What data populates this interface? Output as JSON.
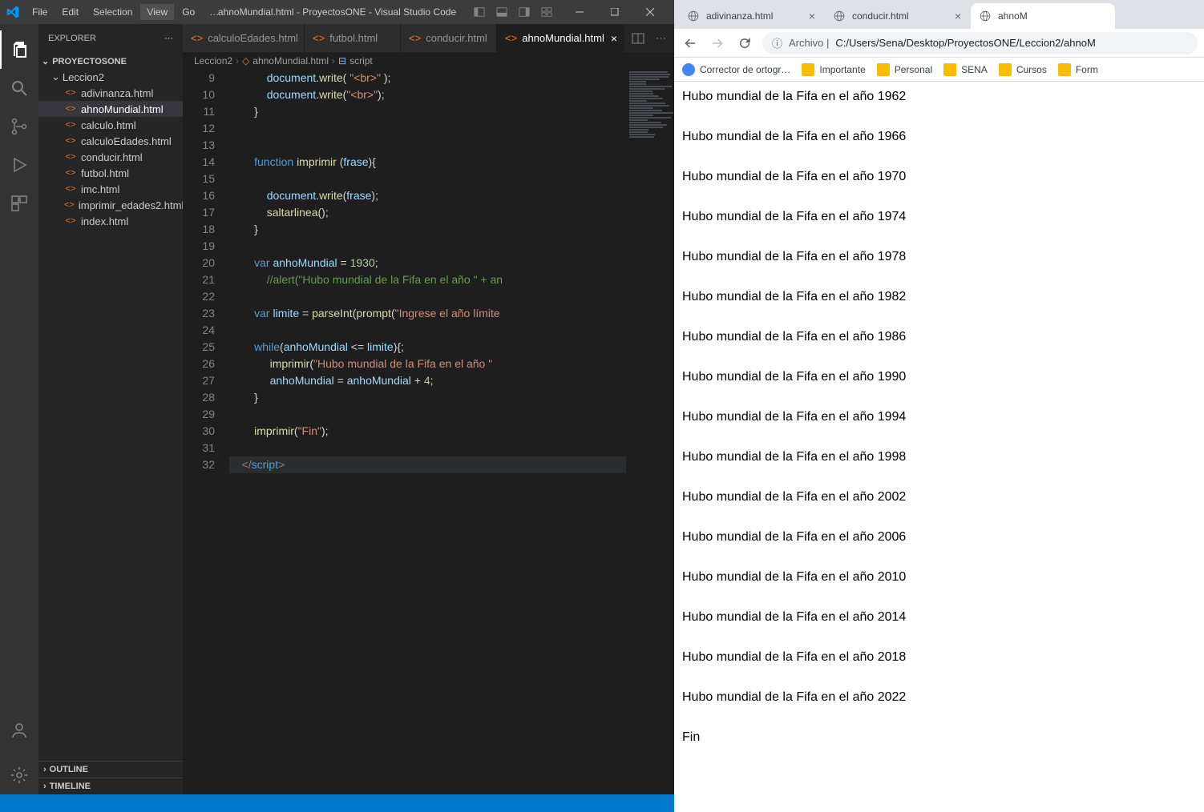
{
  "vscode": {
    "title": "ahnoMundial.html - ProyectosONE - Visual Studio Code",
    "menu": [
      "File",
      "Edit",
      "Selection",
      "View",
      "Go",
      "…"
    ],
    "activeMenu": "View",
    "sidebar": {
      "title": "EXPLORER",
      "project": "PROYECTOSONE",
      "folder": "Leccion2",
      "files": [
        "adivinanza.html",
        "ahnoMundial.html",
        "calculo.html",
        "calculoEdades.html",
        "conducir.html",
        "futbol.html",
        "imc.html",
        "imprimir_edades2.html",
        "index.html"
      ],
      "activeFile": "ahnoMundial.html",
      "outline": "OUTLINE",
      "timeline": "TIMELINE"
    },
    "tabs": [
      {
        "label": "calculoEdades.html",
        "active": false
      },
      {
        "label": "futbol.html",
        "active": false
      },
      {
        "label": "conducir.html",
        "active": false
      },
      {
        "label": "ahnoMundial.html",
        "active": true
      }
    ],
    "breadcrumb": {
      "parts": [
        "Leccion2",
        "ahnoMundial.html",
        "script"
      ]
    },
    "code": {
      "startLine": 9,
      "lines": [
        {
          "n": 9,
          "html": "            <span class='tk-var'>document</span><span class='tk-pun'>.</span><span class='tk-fn'>write</span><span class='tk-pun'>(</span> <span class='tk-str'>\"&lt;br&gt;\"</span> <span class='tk-pun'>);</span>"
        },
        {
          "n": 10,
          "html": "            <span class='tk-var'>document</span><span class='tk-pun'>.</span><span class='tk-fn'>write</span><span class='tk-pun'>(</span><span class='tk-str'>\"&lt;br&gt;\"</span><span class='tk-pun'>);</span>"
        },
        {
          "n": 11,
          "html": "        <span class='tk-pun'>}</span>"
        },
        {
          "n": 12,
          "html": ""
        },
        {
          "n": 13,
          "html": ""
        },
        {
          "n": 14,
          "html": "        <span class='tk-key'>function</span> <span class='tk-fn'>imprimir</span> <span class='tk-pun'>(</span><span class='tk-var'>frase</span><span class='tk-pun'>){</span>"
        },
        {
          "n": 15,
          "html": ""
        },
        {
          "n": 16,
          "html": "            <span class='tk-var'>document</span><span class='tk-pun'>.</span><span class='tk-fn'>write</span><span class='tk-pun'>(</span><span class='tk-var'>frase</span><span class='tk-pun'>);</span>"
        },
        {
          "n": 17,
          "html": "            <span class='tk-fn'>saltarlinea</span><span class='tk-pun'>();</span>"
        },
        {
          "n": 18,
          "html": "        <span class='tk-pun'>}</span>"
        },
        {
          "n": 19,
          "html": ""
        },
        {
          "n": 20,
          "html": "        <span class='tk-key'>var</span> <span class='tk-var'>anhoMundial</span> <span class='tk-pun'>=</span> <span class='tk-num'>1930</span><span class='tk-pun'>;</span>"
        },
        {
          "n": 21,
          "html": "            <span class='tk-cmt'>//alert(\"Hubo mundial de la Fifa en el año \" + an</span>"
        },
        {
          "n": 22,
          "html": ""
        },
        {
          "n": 23,
          "html": "        <span class='tk-key'>var</span> <span class='tk-var'>limite</span> <span class='tk-pun'>=</span> <span class='tk-fn'>parseInt</span><span class='tk-pun'>(</span><span class='tk-fn'>prompt</span><span class='tk-pun'>(</span><span class='tk-str'>\"Ingrese el año límite</span>"
        },
        {
          "n": 24,
          "html": ""
        },
        {
          "n": 25,
          "html": "        <span class='tk-key'>while</span><span class='tk-pun'>(</span><span class='tk-var'>anhoMundial</span> <span class='tk-pun'>&lt;=</span> <span class='tk-var'>limite</span><span class='tk-pun'>){;</span>"
        },
        {
          "n": 26,
          "html": "             <span class='tk-fn'>imprimir</span><span class='tk-pun'>(</span><span class='tk-str'>\"Hubo mundial de la Fifa en el año \"</span>"
        },
        {
          "n": 27,
          "html": "             <span class='tk-var'>anhoMundial</span> <span class='tk-pun'>=</span> <span class='tk-var'>anhoMundial</span> <span class='tk-pun'>+</span> <span class='tk-num'>4</span><span class='tk-pun'>;</span>"
        },
        {
          "n": 28,
          "html": "        <span class='tk-pun'>}</span>"
        },
        {
          "n": 29,
          "html": ""
        },
        {
          "n": 30,
          "html": "        <span class='tk-fn'>imprimir</span><span class='tk-pun'>(</span><span class='tk-str'>\"Fin\"</span><span class='tk-pun'>);</span>"
        },
        {
          "n": 31,
          "html": ""
        },
        {
          "n": 32,
          "html": "    <span class='tk-tag'>&lt;/</span><span class='tk-tagname'>script</span><span class='tk-tag'>&gt;</span>",
          "hl": true
        }
      ]
    }
  },
  "browser": {
    "tabs": [
      {
        "label": "adivinanza.html",
        "active": false
      },
      {
        "label": "conducir.html",
        "active": false
      },
      {
        "label": "ahnoM",
        "active": true
      }
    ],
    "url": {
      "prefix": "Archivo |",
      "path": "C:/Users/Sena/Desktop/ProyectosONE/Leccion2/ahnoM"
    },
    "bookmarks": [
      {
        "label": "Corrector de ortogr…",
        "icon": "app"
      },
      {
        "label": "Importante",
        "icon": "folder"
      },
      {
        "label": "Personal",
        "icon": "folder"
      },
      {
        "label": "SENA",
        "icon": "folder"
      },
      {
        "label": "Cursos",
        "icon": "folder"
      },
      {
        "label": "Form",
        "icon": "folder"
      }
    ],
    "output": [
      "Hubo mundial de la Fifa en el año 1962",
      "Hubo mundial de la Fifa en el año 1966",
      "Hubo mundial de la Fifa en el año 1970",
      "Hubo mundial de la Fifa en el año 1974",
      "Hubo mundial de la Fifa en el año 1978",
      "Hubo mundial de la Fifa en el año 1982",
      "Hubo mundial de la Fifa en el año 1986",
      "Hubo mundial de la Fifa en el año 1990",
      "Hubo mundial de la Fifa en el año 1994",
      "Hubo mundial de la Fifa en el año 1998",
      "Hubo mundial de la Fifa en el año 2002",
      "Hubo mundial de la Fifa en el año 2006",
      "Hubo mundial de la Fifa en el año 2010",
      "Hubo mundial de la Fifa en el año 2014",
      "Hubo mundial de la Fifa en el año 2018",
      "Hubo mundial de la Fifa en el año 2022",
      "Fin"
    ]
  }
}
